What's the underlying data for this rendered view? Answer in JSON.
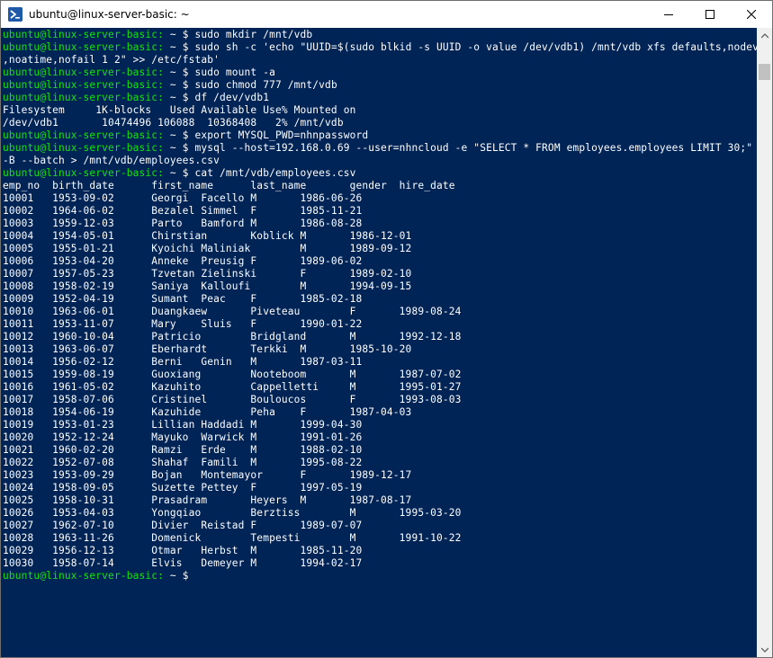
{
  "window": {
    "title": "ubuntu@linux-server-basic: ~"
  },
  "terminal": {
    "prompt": "ubuntu@linux-server-basic:",
    "path": " ~",
    "lines": [
      {
        "p": true,
        "t": " $ sudo mkdir /mnt/vdb"
      },
      {
        "p": true,
        "t": " $ sudo sh -c 'echo \"UUID=$(sudo blkid -s UUID -o value /dev/vdb1) /mnt/vdb xfs defaults,nodev"
      },
      {
        "p": false,
        "t": ",noatime,nofail 1 2\" >> /etc/fstab'"
      },
      {
        "p": true,
        "t": " $ sudo mount -a"
      },
      {
        "p": true,
        "t": " $ sudo chmod 777 /mnt/vdb"
      },
      {
        "p": true,
        "t": " $ df /dev/vdb1"
      },
      {
        "p": false,
        "t": "Filesystem     1K-blocks   Used Available Use% Mounted on"
      },
      {
        "p": false,
        "t": "/dev/vdb1       10474496 106088  10368408   2% /mnt/vdb"
      },
      {
        "p": true,
        "t": " $ export MYSQL_PWD=nhnpassword"
      },
      {
        "p": true,
        "t": " $ mysql --host=192.168.0.69 --user=nhncloud -e \"SELECT * FROM employees.employees LIMIT 30;\""
      },
      {
        "p": false,
        "t": "-B --batch > /mnt/vdb/employees.csv"
      },
      {
        "p": true,
        "t": " $ cat /mnt/vdb/employees.csv"
      },
      {
        "p": false,
        "t": "emp_no  birth_date      first_name      last_name       gender  hire_date"
      },
      {
        "p": false,
        "t": "10001   1953-09-02      Georgi  Facello M       1986-06-26"
      },
      {
        "p": false,
        "t": "10002   1964-06-02      Bezalel Simmel  F       1985-11-21"
      },
      {
        "p": false,
        "t": "10003   1959-12-03      Parto   Bamford M       1986-08-28"
      },
      {
        "p": false,
        "t": "10004   1954-05-01      Chirstian       Koblick M       1986-12-01"
      },
      {
        "p": false,
        "t": "10005   1955-01-21      Kyoichi Maliniak        M       1989-09-12"
      },
      {
        "p": false,
        "t": "10006   1953-04-20      Anneke  Preusig F       1989-06-02"
      },
      {
        "p": false,
        "t": "10007   1957-05-23      Tzvetan Zielinski       F       1989-02-10"
      },
      {
        "p": false,
        "t": "10008   1958-02-19      Saniya  Kalloufi        M       1994-09-15"
      },
      {
        "p": false,
        "t": "10009   1952-04-19      Sumant  Peac    F       1985-02-18"
      },
      {
        "p": false,
        "t": "10010   1963-06-01      Duangkaew       Piveteau        F       1989-08-24"
      },
      {
        "p": false,
        "t": "10011   1953-11-07      Mary    Sluis   F       1990-01-22"
      },
      {
        "p": false,
        "t": "10012   1960-10-04      Patricio        Bridgland       M       1992-12-18"
      },
      {
        "p": false,
        "t": "10013   1963-06-07      Eberhardt       Terkki  M       1985-10-20"
      },
      {
        "p": false,
        "t": "10014   1956-02-12      Berni   Genin   M       1987-03-11"
      },
      {
        "p": false,
        "t": "10015   1959-08-19      Guoxiang        Nooteboom       M       1987-07-02"
      },
      {
        "p": false,
        "t": "10016   1961-05-02      Kazuhito        Cappelletti     M       1995-01-27"
      },
      {
        "p": false,
        "t": "10017   1958-07-06      Cristinel       Bouloucos       F       1993-08-03"
      },
      {
        "p": false,
        "t": "10018   1954-06-19      Kazuhide        Peha    F       1987-04-03"
      },
      {
        "p": false,
        "t": "10019   1953-01-23      Lillian Haddadi M       1999-04-30"
      },
      {
        "p": false,
        "t": "10020   1952-12-24      Mayuko  Warwick M       1991-01-26"
      },
      {
        "p": false,
        "t": "10021   1960-02-20      Ramzi   Erde    M       1988-02-10"
      },
      {
        "p": false,
        "t": "10022   1952-07-08      Shahaf  Famili  M       1995-08-22"
      },
      {
        "p": false,
        "t": "10023   1953-09-29      Bojan   Montemayor      F       1989-12-17"
      },
      {
        "p": false,
        "t": "10024   1958-09-05      Suzette Pettey  F       1997-05-19"
      },
      {
        "p": false,
        "t": "10025   1958-10-31      Prasadram       Heyers  M       1987-08-17"
      },
      {
        "p": false,
        "t": "10026   1953-04-03      Yongqiao        Berztiss        M       1995-03-20"
      },
      {
        "p": false,
        "t": "10027   1962-07-10      Divier  Reistad F       1989-07-07"
      },
      {
        "p": false,
        "t": "10028   1963-11-26      Domenick        Tempesti        M       1991-10-22"
      },
      {
        "p": false,
        "t": "10029   1956-12-13      Otmar   Herbst  M       1985-11-20"
      },
      {
        "p": false,
        "t": "10030   1958-07-14      Elvis   Demeyer M       1994-02-17"
      },
      {
        "p": true,
        "t": " $ "
      }
    ]
  },
  "colors": {
    "background": "#012456",
    "prompt": "#13e213",
    "text": "#ffffff"
  },
  "icons": {
    "app": "powershell-terminal-icon",
    "minimize": "minimize-icon",
    "maximize": "maximize-icon",
    "close": "close-icon"
  }
}
